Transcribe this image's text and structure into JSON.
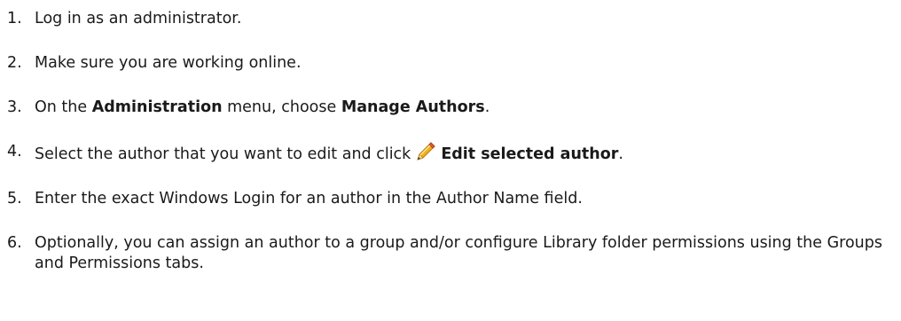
{
  "steps": [
    {
      "num": "1.",
      "text": "Log in as an administrator."
    },
    {
      "num": "2.",
      "text": "Make sure you are working online."
    },
    {
      "num": "3.",
      "pre": "On the ",
      "bold1": "Administration",
      "mid": " menu, choose ",
      "bold2": "Manage Authors",
      "post": "."
    },
    {
      "num": "4.",
      "pre": "Select the author that you want to edit and click",
      "icon": "pencil-icon",
      "bold": "Edit selected author",
      "post": "."
    },
    {
      "num": "5.",
      "text": "Enter the exact Windows Login for an author in the Author Name field."
    },
    {
      "num": "6.",
      "text": "Optionally, you can assign an author to a group and/or configure Library folder permissions using the Groups and Permissions tabs."
    }
  ]
}
